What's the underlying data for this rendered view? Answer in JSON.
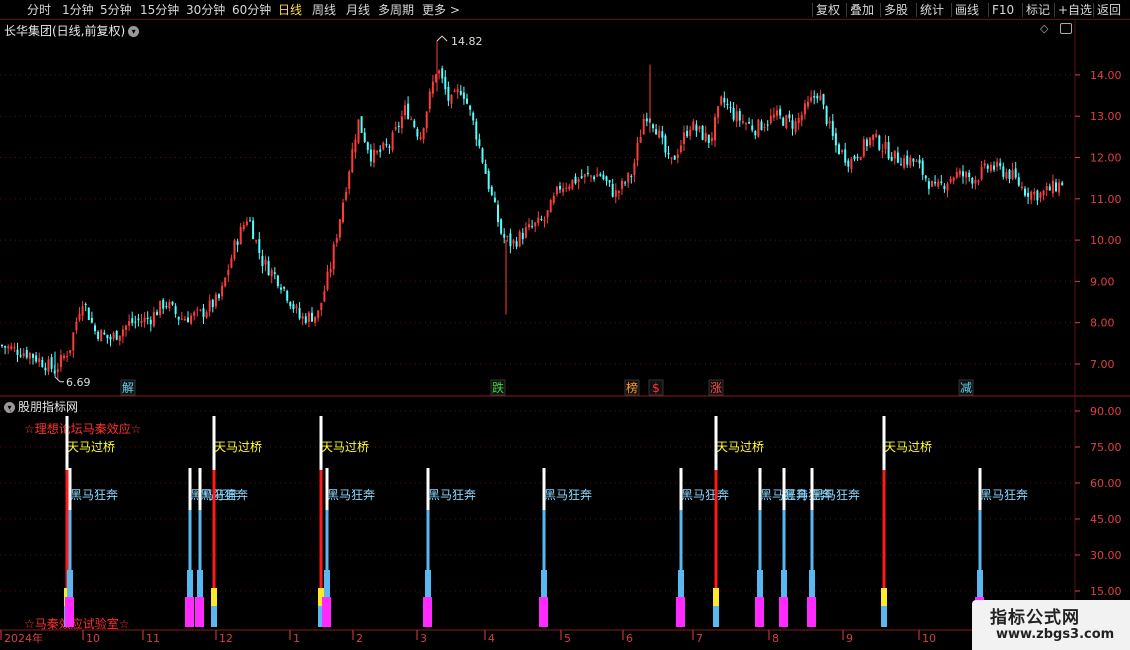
{
  "toolbar": {
    "left": [
      "分时",
      "1分钟",
      "5分钟",
      "15分钟",
      "30分钟",
      "60分钟",
      "日线",
      "周线",
      "月线",
      "多周期",
      "更多 >"
    ],
    "active": "日线",
    "right": [
      "复权",
      "叠加",
      "多股",
      "统计",
      "画线",
      "F10",
      "标记",
      "+自选",
      "返回"
    ]
  },
  "main_chart": {
    "title": "长华集团(日线,前复权)",
    "price_ticks": [
      "14.00",
      "13.00",
      "12.00",
      "11.00",
      "10.00",
      "9.00",
      "8.00",
      "7.00"
    ],
    "high_label": "14.82",
    "low_label": "6.69",
    "markers": [
      {
        "text": "解",
        "color": "#5ad8f0"
      },
      {
        "text": "跌",
        "color": "#3ed83e"
      },
      {
        "text": "榜",
        "color": "#ff9a2a"
      },
      {
        "text": "$",
        "color": "#ff3030"
      },
      {
        "text": "涨",
        "color": "#ff4a4a"
      },
      {
        "text": "减",
        "color": "#5ad8f0"
      }
    ]
  },
  "indicator": {
    "title": "股朋指标网",
    "top_text": "☆理想论坛马秦效应☆",
    "bottom_text": "☆马秦效应试验室☆",
    "ticks": [
      "90.00",
      "75.00",
      "60.00",
      "45.00",
      "30.00",
      "15.00"
    ],
    "signal_a": "天马过桥",
    "signal_b": "黑马狂奔"
  },
  "dates": [
    "2024年",
    "10",
    "11",
    "12",
    "1",
    "2",
    "3",
    "4",
    "5",
    "6",
    "7",
    "8",
    "9",
    "10"
  ],
  "logo": {
    "main": "指标公式网",
    "url": "www.zbgs3.com"
  },
  "colors": {
    "up": "#ff3c3c",
    "down": "#54ffff",
    "grid": "#5a1010",
    "axis": "#e04040"
  }
}
